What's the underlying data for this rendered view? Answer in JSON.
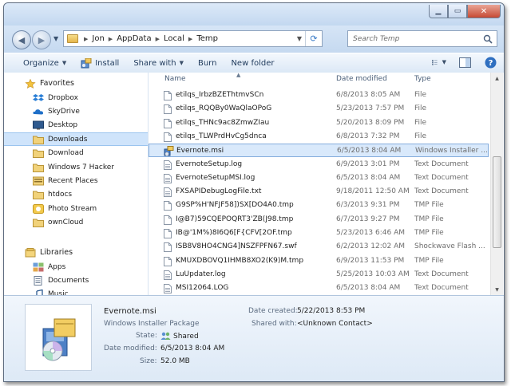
{
  "breadcrumb": [
    "Jon",
    "AppData",
    "Local",
    "Temp"
  ],
  "search": {
    "placeholder": "Search Temp"
  },
  "toolbar": {
    "organize": "Organize",
    "install": "Install",
    "share_with": "Share with",
    "burn": "Burn",
    "new_folder": "New folder"
  },
  "nav": {
    "favorites_label": "Favorites",
    "favorites": [
      "Dropbox",
      "SkyDrive",
      "Desktop",
      "Downloads",
      "Download",
      "Windows 7 Hacker",
      "Recent Places",
      "htdocs",
      "Photo Stream",
      "ownCloud"
    ],
    "selected": "Downloads",
    "libraries_label": "Libraries",
    "libraries": [
      "Apps",
      "Documents",
      "Music"
    ]
  },
  "columns": {
    "name": "Name",
    "date": "Date modified",
    "type": "Type"
  },
  "files": [
    {
      "name": "etilqs_IrbzBZEThtmvSCn",
      "date": "6/8/2013 8:05 AM",
      "type": "File",
      "icon": "file-icon"
    },
    {
      "name": "etilqs_RQQBy0WaQlaOPoG",
      "date": "5/23/2013 7:57 PM",
      "type": "File",
      "icon": "file-icon"
    },
    {
      "name": "etilqs_THNc9ac8ZmwZIau",
      "date": "5/20/2013 8:09 PM",
      "type": "File",
      "icon": "file-icon"
    },
    {
      "name": "etilqs_TLWPrdHvCg5dnca",
      "date": "6/8/2013 7:32 PM",
      "type": "File",
      "icon": "file-icon"
    },
    {
      "name": "Evernote.msi",
      "date": "6/5/2013 8:04 AM",
      "type": "Windows Installer ...",
      "icon": "installer-icon",
      "selected": true
    },
    {
      "name": "EvernoteSetup.log",
      "date": "6/9/2013 3:01 PM",
      "type": "Text Document",
      "icon": "text-file-icon"
    },
    {
      "name": "EvernoteSetupMSI.log",
      "date": "6/5/2013 8:04 AM",
      "type": "Text Document",
      "icon": "text-file-icon"
    },
    {
      "name": "FXSAPIDebugLogFile.txt",
      "date": "9/18/2011 12:50 AM",
      "type": "Text Document",
      "icon": "text-file-icon"
    },
    {
      "name": "G9SP%H'NFJF58])SX[DO4A0.tmp",
      "date": "6/3/2013 9:31 PM",
      "type": "TMP File",
      "icon": "file-icon"
    },
    {
      "name": "I@B7)59CQEPOQRT3'ZB(J98.tmp",
      "date": "6/7/2013 9:27 PM",
      "type": "TMP File",
      "icon": "file-icon"
    },
    {
      "name": "IB@'1M%)8I6Q6[F{CFV[2OF.tmp",
      "date": "5/23/2013 6:46 AM",
      "type": "TMP File",
      "icon": "file-icon"
    },
    {
      "name": "ISB8V8HO4CNG4]NSZFPFN67.swf",
      "date": "6/2/2013 12:02 AM",
      "type": "Shockwave Flash ...",
      "icon": "file-icon"
    },
    {
      "name": "KMUXDBOVQ1IHMB8XO2(K9)M.tmp",
      "date": "6/9/2013 11:53 PM",
      "type": "TMP File",
      "icon": "file-icon"
    },
    {
      "name": "LuUpdater.log",
      "date": "5/25/2013 10:03 AM",
      "type": "Text Document",
      "icon": "text-file-icon"
    },
    {
      "name": "MSI12064.LOG",
      "date": "6/5/2013 8:04 AM",
      "type": "Text Document",
      "icon": "text-file-icon"
    }
  ],
  "details": {
    "title": "Evernote.msi",
    "subtitle": "Windows Installer Package",
    "state_label": "State:",
    "state_value": "Shared",
    "modified_label": "Date modified:",
    "modified_value": "6/5/2013 8:04 AM",
    "size_label": "Size:",
    "size_value": "52.0 MB",
    "created_label": "Date created:",
    "created_value": "5/22/2013 8:53 PM",
    "shared_label": "Shared with:",
    "shared_value": "<Unknown Contact>"
  },
  "colors": {
    "accent": "#cfe4fb",
    "window_frame": "#c9dcf2",
    "close": "#c64a34"
  }
}
